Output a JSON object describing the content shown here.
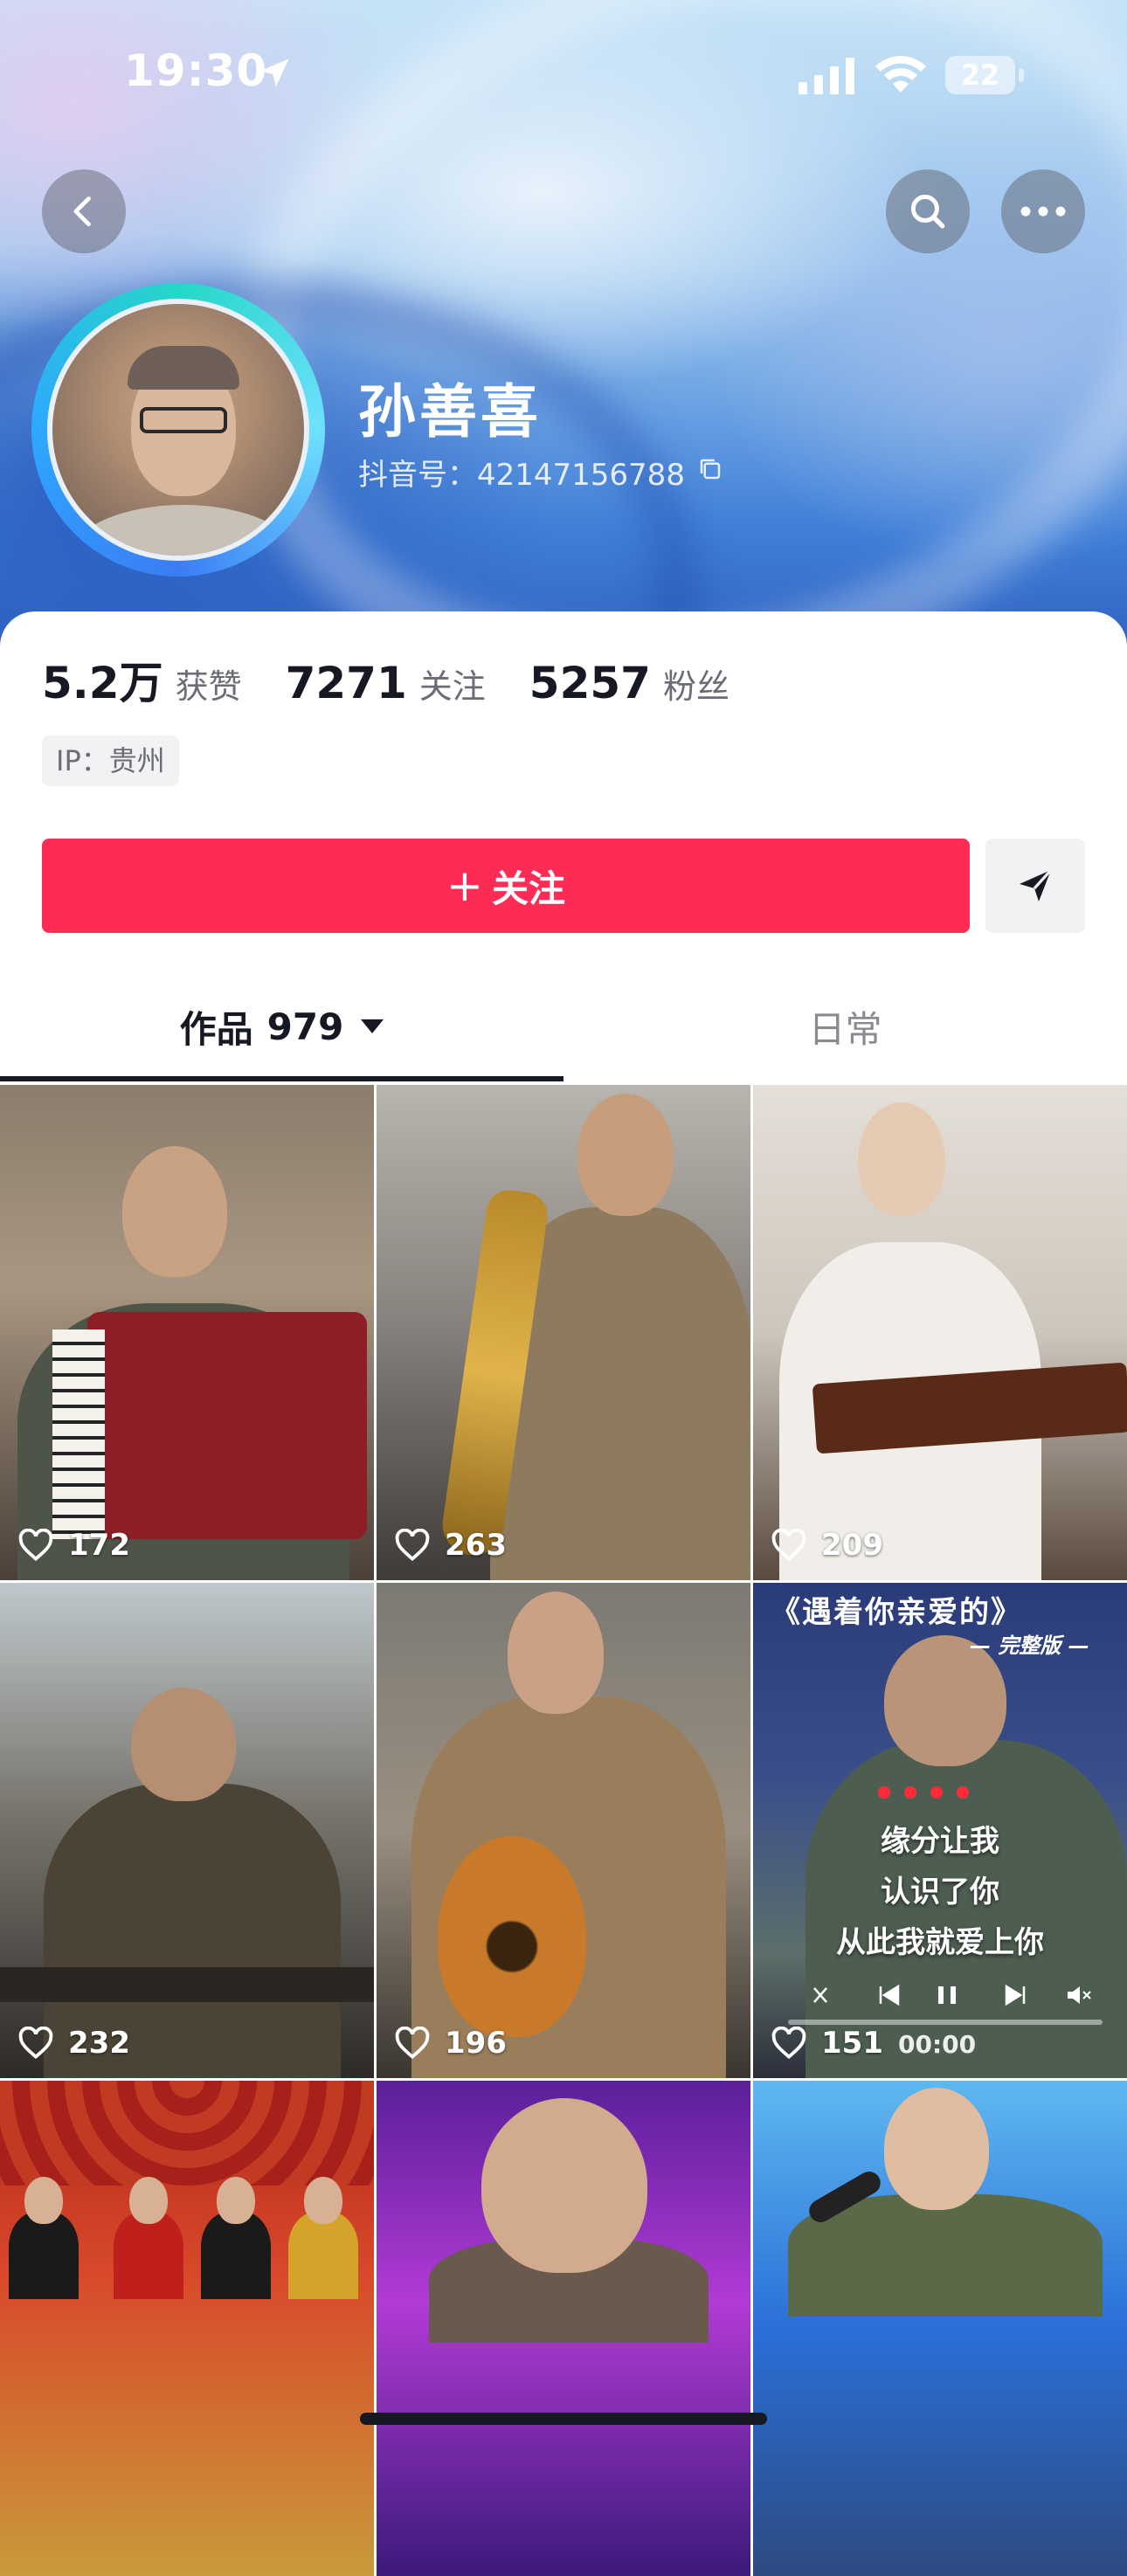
{
  "status_bar": {
    "time": "19:30",
    "battery": "22"
  },
  "profile": {
    "nickname": "孙善喜",
    "douyin_id": "抖音号：42147156788",
    "stats": [
      {
        "value": "5.2万",
        "label": "获赞"
      },
      {
        "value": "7271",
        "label": "关注"
      },
      {
        "value": "5257",
        "label": "粉丝"
      }
    ],
    "ip": "IP：贵州"
  },
  "actions": {
    "follow_label": "关注"
  },
  "tabs": {
    "works_label": "作品",
    "works_count": "979",
    "daily_label": "日常"
  },
  "videos": [
    {
      "likes": "172"
    },
    {
      "likes": "263"
    },
    {
      "likes": "209"
    },
    {
      "likes": "232"
    },
    {
      "likes": "196"
    },
    {
      "likes": "151",
      "title": "《遇着你亲爱的》",
      "subtitle": "— 完整版 —",
      "lyrics": [
        "缘分让我",
        "认识了你",
        "从此我就爱上你"
      ],
      "time": "00:00"
    },
    {
      "likes": ""
    },
    {
      "likes": ""
    },
    {
      "likes": ""
    }
  ],
  "colors": {
    "follow_button": "#fe2c55",
    "text_primary": "#161823",
    "text_secondary": "#6b6d76"
  }
}
